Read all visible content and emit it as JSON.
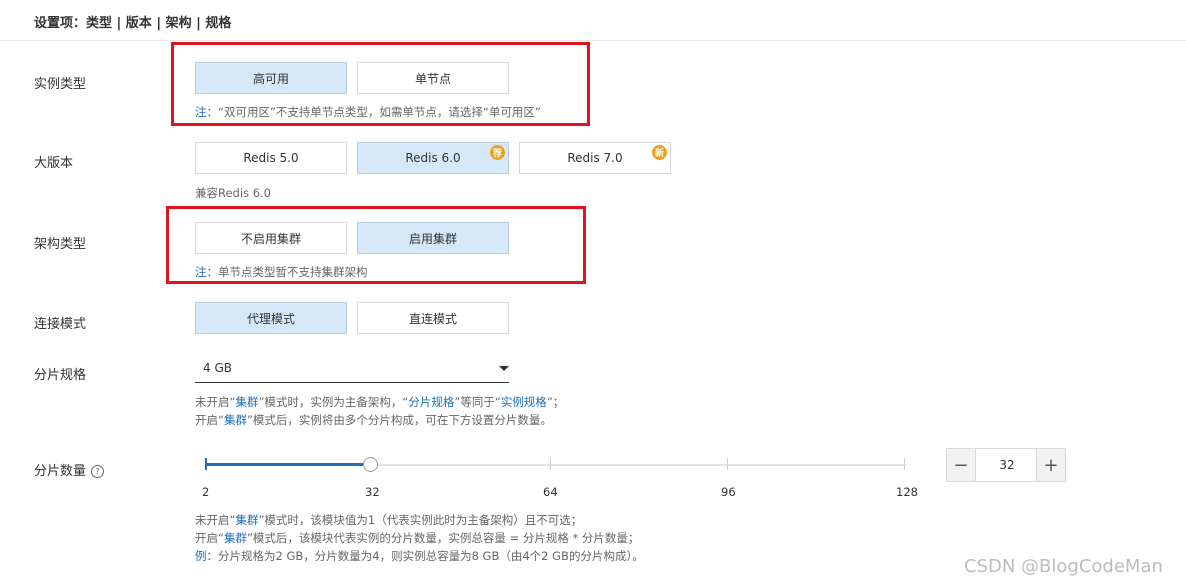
{
  "header": {
    "title": "设置项：类型 | 版本 | 架构 | 规格"
  },
  "instance_type": {
    "label": "实例类型",
    "options": [
      "高可用",
      "单节点"
    ],
    "note_prefix": "注：",
    "note_text": "“双可用区”不支持单节点类型，如需单节点，请选择“单可用区”"
  },
  "version": {
    "label": "大版本",
    "options": [
      "Redis 5.0",
      "Redis 6.0",
      "Redis 7.0"
    ],
    "badges": [
      "荐",
      "新"
    ],
    "note": "兼容Redis 6.0"
  },
  "architecture": {
    "label": "架构类型",
    "options": [
      "不启用集群",
      "启用集群"
    ],
    "note_prefix": "注：",
    "note_text": "单节点类型暂不支持集群架构"
  },
  "connection": {
    "label": "连接模式",
    "options": [
      "代理模式",
      "直连模式"
    ]
  },
  "shard_spec": {
    "label": "分片规格",
    "value": "4 GB",
    "note_line1": [
      "未开启“",
      "集群",
      "”模式时，实例为主备架构，“",
      "分片规格",
      "”等同于“",
      "实例规格",
      "”；"
    ],
    "note_line2": [
      "开启“",
      "集群",
      "”模式后，实例将由多个分片构成，可在下方设置分片数量。"
    ]
  },
  "shard_count": {
    "label": "分片数量",
    "help_icon": "?",
    "ticks": [
      "2",
      "32",
      "64",
      "96",
      "128"
    ],
    "value": "32",
    "minus": "−",
    "plus": "+",
    "note_line1": [
      "未开启“",
      "集群",
      "”模式时，该模块值为1（代表实例此时为主备架构）且不可选；"
    ],
    "note_line2": [
      "开启“",
      "集群",
      "”模式后，该模块代表实例的分片数量，实例总容量 = 分片规格 * 分片数量；"
    ],
    "note_line3": [
      "例：",
      "分片规格为2 GB，分片数量为4，则实例总容量为8 GB（由4个2 GB的分片构成）。"
    ]
  },
  "watermark": "CSDN @BlogCodeMan",
  "colors": {
    "accent": "#1c6fb8",
    "selected_bg": "#d6e8f8",
    "highlight_box": "#e0141b",
    "badge": "#f0a020"
  }
}
